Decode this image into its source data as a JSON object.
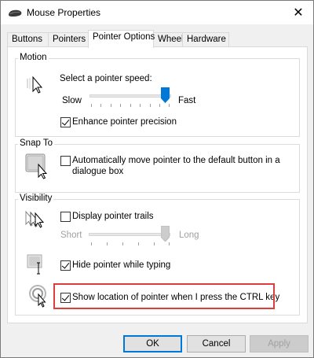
{
  "window": {
    "title": "Mouse Properties",
    "close_glyph": "✕"
  },
  "tabs": [
    {
      "label": "Buttons"
    },
    {
      "label": "Pointers"
    },
    {
      "label": "Pointer Options",
      "active": true
    },
    {
      "label": "Wheel"
    },
    {
      "label": "Hardware"
    }
  ],
  "motion": {
    "group_label": "Motion",
    "speed_label": "Select a pointer speed:",
    "slow_label": "Slow",
    "fast_label": "Fast",
    "speed_value": 1.0,
    "enhance_label": "Enhance pointer precision",
    "enhance_checked": true
  },
  "snap_to": {
    "group_label": "Snap To",
    "auto_move_label_line1": "Automatically move pointer to the default button in a",
    "auto_move_label_line2": "dialogue box",
    "auto_move_checked": false
  },
  "visibility": {
    "group_label": "Visibility",
    "trails_label": "Display pointer trails",
    "trails_checked": false,
    "short_label": "Short",
    "long_label": "Long",
    "trails_value": 1.0,
    "hide_label": "Hide pointer while typing",
    "hide_checked": true,
    "show_location_label": "Show location of pointer when I press the CTRL key",
    "show_location_checked": true
  },
  "buttons": {
    "ok": "OK",
    "cancel": "Cancel",
    "apply": "Apply"
  },
  "colors": {
    "accent": "#0078d7",
    "highlight": "#e03c3c"
  }
}
